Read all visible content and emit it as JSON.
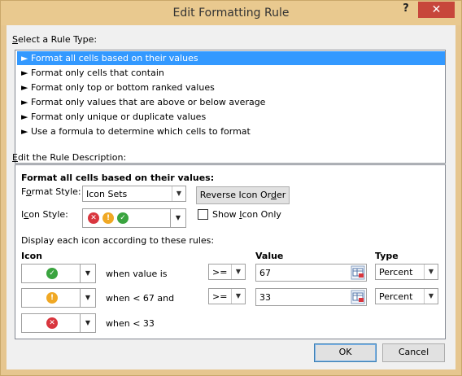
{
  "window": {
    "title": "Edit Formatting Rule",
    "help_glyph": "?",
    "close_glyph": "✕"
  },
  "rule_type": {
    "label_prefix": "S",
    "label_rest": "elect a Rule Type:",
    "items": [
      "Format all cells based on their values",
      "Format only cells that contain",
      "Format only top or bottom ranked values",
      "Format only values that are above or below average",
      "Format only unique or duplicate values",
      "Use a formula to determine which cells to format"
    ],
    "selected_index": 0,
    "arrow_glyph": "►"
  },
  "description": {
    "label_prefix": "E",
    "label_rest": "dit the Rule Description:",
    "heading": "Format all cells based on their values:",
    "format_style_label_pre": "F",
    "format_style_label_ul": "o",
    "format_style_label_post": "rmat Style:",
    "format_style_value": "Icon Sets",
    "reverse_button_pre": "Reverse Icon Or",
    "reverse_button_ul": "d",
    "reverse_button_post": "er",
    "icon_style_label_pre": "I",
    "icon_style_label_ul": "c",
    "icon_style_label_post": "on Style:",
    "show_icon_only_pre": "Show ",
    "show_icon_only_ul": "I",
    "show_icon_only_post": "con Only",
    "show_icon_only_checked": false,
    "rules_intro": "Display each icon according to these rules:",
    "col_icon": "Icon",
    "col_value": "Value",
    "col_type": "Type",
    "rows": [
      {
        "icon": "green-check-icon",
        "condition": "when value is",
        "operator": ">=",
        "value": "67",
        "type": "Percent"
      },
      {
        "icon": "yellow-exclamation-icon",
        "condition": "when < 67 and",
        "operator": ">=",
        "value": "33",
        "type": "Percent"
      },
      {
        "icon": "red-x-icon",
        "condition": "when < 33"
      }
    ]
  },
  "footer": {
    "ok_label": "OK",
    "cancel_label": "Cancel"
  },
  "colors": {
    "title_bar": "#e9c98f",
    "close_button": "#c7463b",
    "selection": "#3399ff",
    "icon_red": "#d9363e",
    "icon_yellow": "#f0a824",
    "icon_green": "#3aa43f"
  }
}
